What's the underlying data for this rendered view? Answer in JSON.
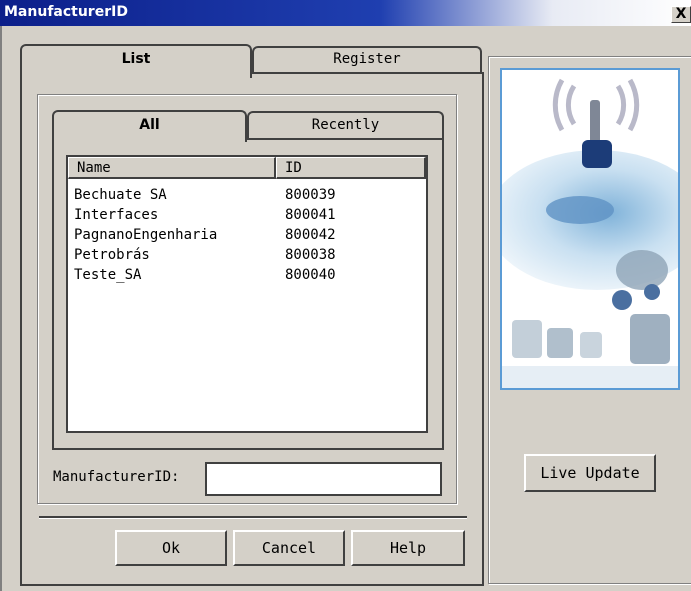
{
  "window": {
    "title": "ManufacturerID",
    "close_glyph": "X"
  },
  "tabs": {
    "list": "List",
    "register": "Register"
  },
  "subtabs": {
    "all": "All",
    "recently": "Recently"
  },
  "table": {
    "headers": {
      "name": "Name",
      "id": "ID"
    },
    "rows": [
      {
        "name": "Bechuate SA",
        "id": "800039"
      },
      {
        "name": "Interfaces",
        "id": "800041"
      },
      {
        "name": "PagnanoEngenharia",
        "id": "800042"
      },
      {
        "name": "Petrobrás",
        "id": "800038"
      },
      {
        "name": "Teste_SA",
        "id": "800040"
      }
    ]
  },
  "form": {
    "manufacturer_label": "ManufacturerID:",
    "manufacturer_value": ""
  },
  "buttons": {
    "ok": "Ok",
    "cancel": "Cancel",
    "help": "Help",
    "live_update": "Live Update"
  },
  "colors": {
    "title_blue": "#0c1f8a",
    "face": "#d4d0c8",
    "image_frame": "#5b9bd5"
  }
}
